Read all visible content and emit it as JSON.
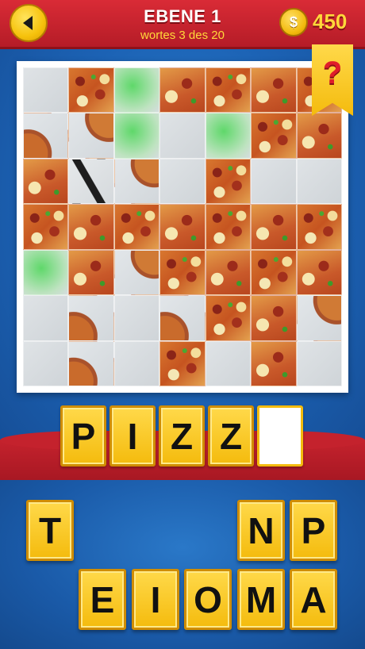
{
  "header": {
    "title": "EBENE 1",
    "subtitle": "wortes 3 des 20",
    "coins": "450",
    "coin_symbol": "$"
  },
  "hint": {
    "label": "?"
  },
  "answer": {
    "slots": [
      "P",
      "I",
      "Z",
      "Z",
      ""
    ]
  },
  "keys": {
    "row1": [
      "T",
      "",
      "",
      "",
      "N",
      "P"
    ],
    "row2": [
      "E",
      "I",
      "O",
      "M",
      "A"
    ]
  },
  "colors": {
    "header_red": "#c4222d",
    "tile_yellow": "#f4bb0d",
    "background_blue": "#1a5aa8",
    "coin_gold": "#f2b90c"
  }
}
